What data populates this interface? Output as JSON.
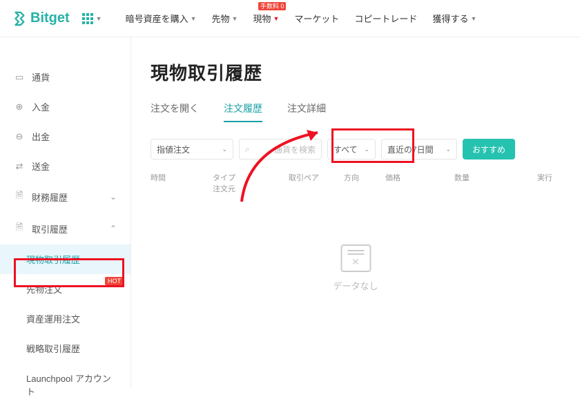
{
  "brand": "Bitget",
  "nav": {
    "buy": "暗号資産を購入",
    "futures": "先物",
    "spot": "現物",
    "spot_badge": "手数料 0",
    "market": "マーケット",
    "copytrade": "コピートレード",
    "earn": "獲得する"
  },
  "sidebar": {
    "currency": "通貨",
    "deposit": "入金",
    "withdraw": "出金",
    "transfer": "送金",
    "finhistory": "財務履歴",
    "tradehistory": "取引履歴",
    "sub": {
      "spot_history": "現物取引履歴",
      "futures_orders": "先物注文",
      "asset_orders": "資産運用注文",
      "strategy_history": "戦略取引履歴",
      "launchpool": "Launchpool アカウント"
    },
    "hot": "HOT"
  },
  "page": {
    "title": "現物取引履歴",
    "tabs": {
      "open": "注文を開く",
      "history": "注文履歴",
      "detail": "注文詳細"
    }
  },
  "filters": {
    "order_type": "指値注文",
    "pair_ph": "通貨を検索",
    "side": "すべて",
    "range": "直近の7日間",
    "recommend": "おすすめ"
  },
  "columns": {
    "time": "時間",
    "type": "タイプ",
    "source": "注文元",
    "pair": "取引ペア",
    "direction": "方向",
    "price": "価格",
    "amount": "数量",
    "exec": "実行"
  },
  "empty": "データなし"
}
